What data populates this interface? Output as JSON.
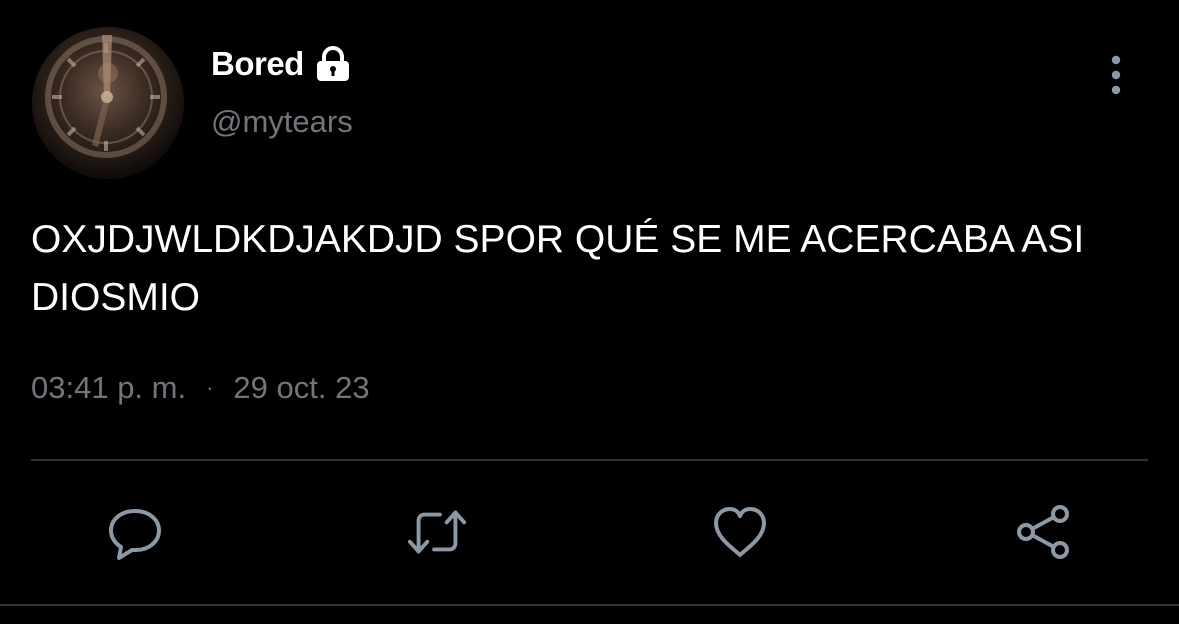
{
  "user": {
    "display_name": "Bored",
    "handle": "@mytears",
    "protected_icon": "lock-icon",
    "avatar": "clock-photo-avatar"
  },
  "tweet": {
    "text": "OXJDJWLDKDJAKDJD SPOR QUÉ SE ME ACERCABA ASI DIOSMIO",
    "time": "03:41 p. m.",
    "separator": "·",
    "date": "29 oct. 23"
  },
  "actions": {
    "more": "more-vertical-icon",
    "reply": "reply-icon",
    "retweet": "retweet-icon",
    "like": "heart-icon",
    "share": "share-icon"
  },
  "colors": {
    "background": "#000000",
    "primary_text": "#ffffff",
    "secondary_text": "#71767b",
    "divider": "#2f3336",
    "icon": "#8b98a5"
  }
}
